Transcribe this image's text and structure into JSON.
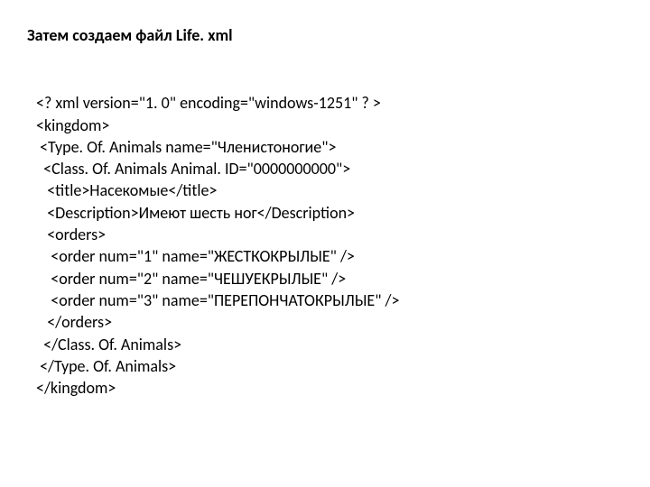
{
  "heading": "Затем создаем файл Life. xml",
  "code": {
    "l1": "<? xml version=\"1. 0\" encoding=\"windows-1251\" ? >",
    "l2": "<kingdom>",
    "l3": " <Type. Of. Animals name=\"Членистоногие\">",
    "l4": "  <Class. Of. Animals Animal. ID=\"0000000000\">",
    "l5": "   <title>Насекомые</title>",
    "l6": "   <Description>Имеют шесть ног</Description>",
    "l7": "   <orders>",
    "l8": "    <order num=\"1\" name=\"ЖЕСТКОКРЫЛЫЕ\" />",
    "l9": "    <order num=\"2\" name=\"ЧЕШУЕКРЫЛЫЕ\" />",
    "l10": "    <order num=\"3\" name=\"ПЕРЕПОНЧАТОКРЫЛЫЕ\" />",
    "l11": "   </orders>",
    "l12": "  </Class. Of. Animals>",
    "l13": " </Type. Of. Animals>",
    "l14": "</kingdom>"
  }
}
